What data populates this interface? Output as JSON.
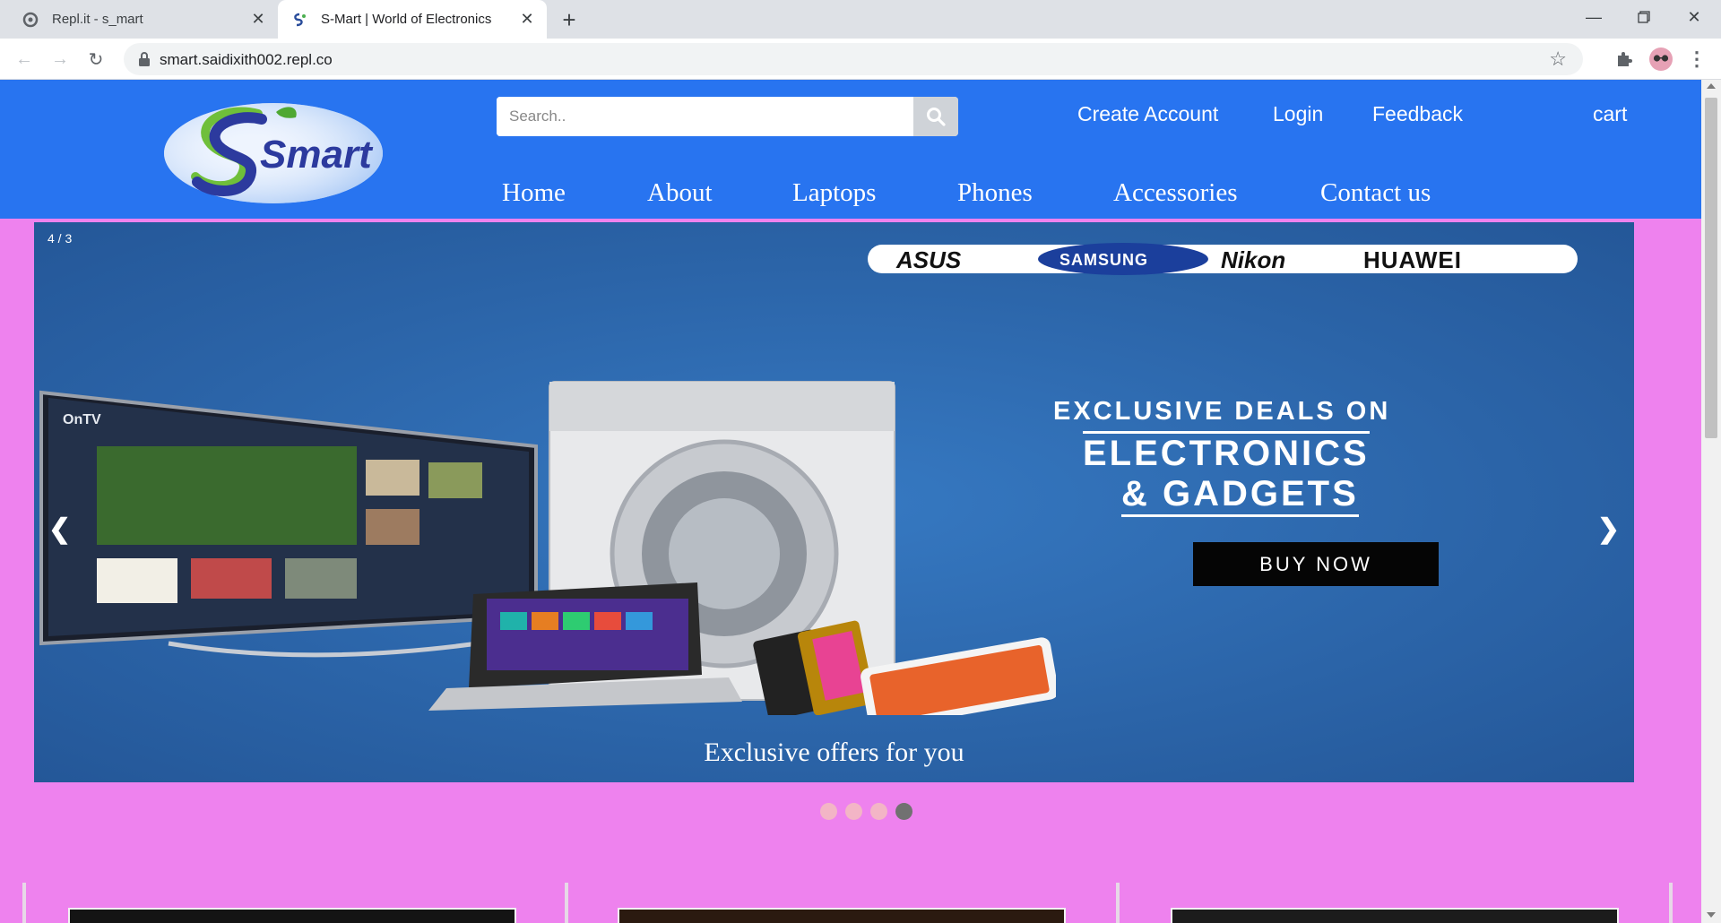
{
  "browser": {
    "tabs": [
      {
        "title": "Repl.it - s_mart",
        "active": false,
        "icon": "replit-icon"
      },
      {
        "title": "S-Mart | World of Electronics",
        "active": true,
        "icon": "smart-favicon-icon"
      }
    ],
    "new_tab_icon": "plus-icon",
    "url": "smart.saidixith002.repl.co"
  },
  "header": {
    "logo_text": "Smart",
    "search_placeholder": "Search..",
    "top_links": {
      "create_account": "Create Account",
      "login": "Login",
      "feedback": "Feedback",
      "cart": "cart"
    },
    "nav": [
      "Home",
      "About",
      "Laptops",
      "Phones",
      "Accessories",
      "Contact us"
    ]
  },
  "slideshow": {
    "counter": "4 / 3",
    "brands": [
      "ASUS",
      "SAMSUNG",
      "Nikon",
      "HUAWEI"
    ],
    "headline_1": "EXCLUSIVE DEALS ON",
    "headline_2": "ELECTRONICS",
    "headline_3": "& GADGETS",
    "cta": "BUY NOW",
    "caption": "Exclusive offers for you",
    "prev": "❮",
    "next": "❯",
    "dot_count": 4,
    "active_dot": 4
  },
  "colors": {
    "header_blue": "#2874f0",
    "page_bg": "#ee82ee",
    "dot_inactive": "#f3b5c6",
    "dot_active": "#717171"
  }
}
